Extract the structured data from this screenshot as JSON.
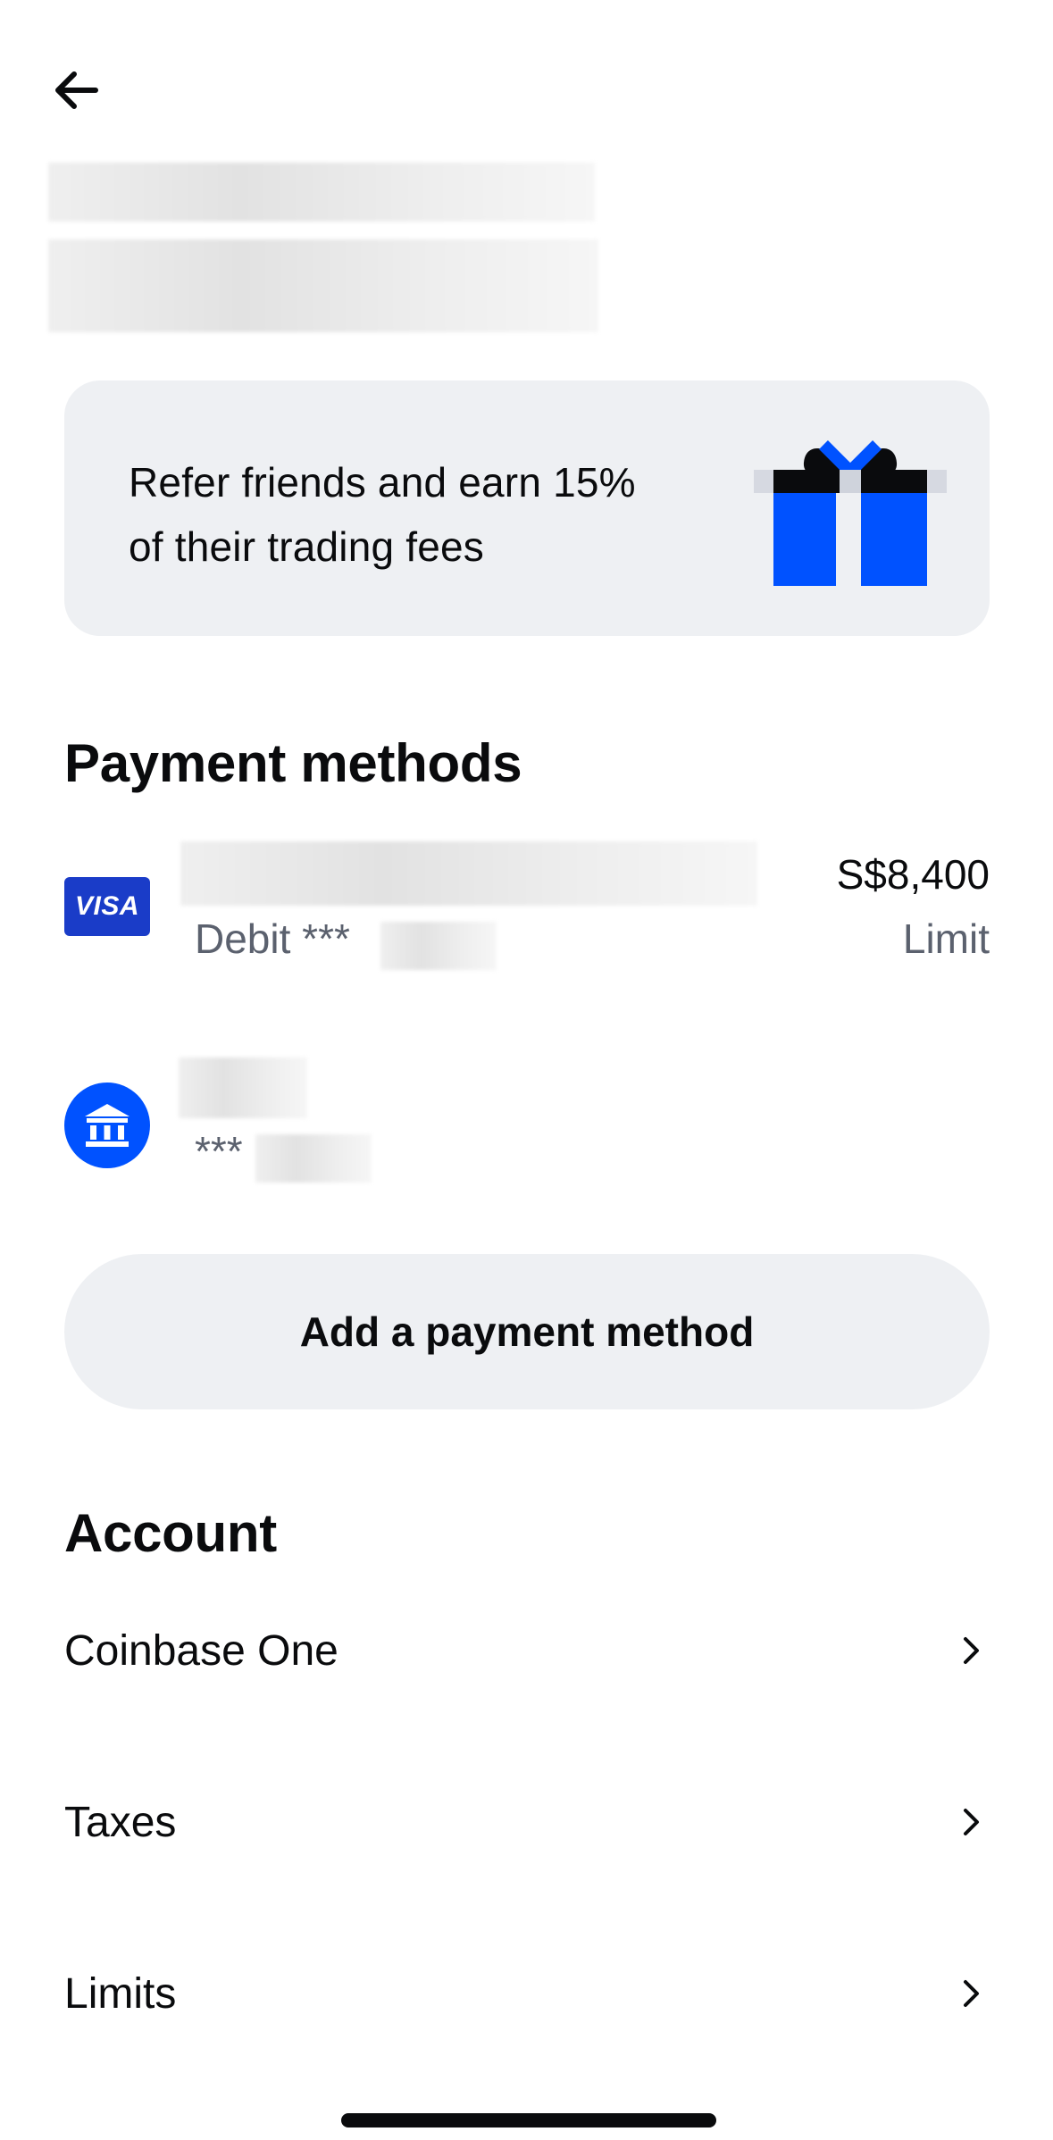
{
  "header": {
    "back_icon": "arrow-left-icon"
  },
  "referral": {
    "text_line1": "Refer friends and earn 15%",
    "text_line2": "of their trading fees",
    "icon": "gift-icon",
    "colors": {
      "gift_blue": "#0052ff",
      "ribbon_dark": "#0a0b0d"
    }
  },
  "payment_methods": {
    "title": "Payment methods",
    "items": [
      {
        "type_icon": "visa-card-icon",
        "logo_text": "VISA",
        "subtitle": "Debit ***",
        "amount": "S$8,400",
        "amount_label": "Limit"
      },
      {
        "type_icon": "bank-icon",
        "subtitle": "***"
      }
    ],
    "add_button_label": "Add a payment method"
  },
  "account": {
    "title": "Account",
    "items": [
      {
        "label": "Coinbase One",
        "icon": "chevron-right-icon"
      },
      {
        "label": "Taxes",
        "icon": "chevron-right-icon"
      },
      {
        "label": "Limits",
        "icon": "chevron-right-icon"
      }
    ]
  },
  "colors": {
    "accent": "#0052ff",
    "card_bg": "#eef0f3",
    "muted_text": "#5b616e"
  }
}
